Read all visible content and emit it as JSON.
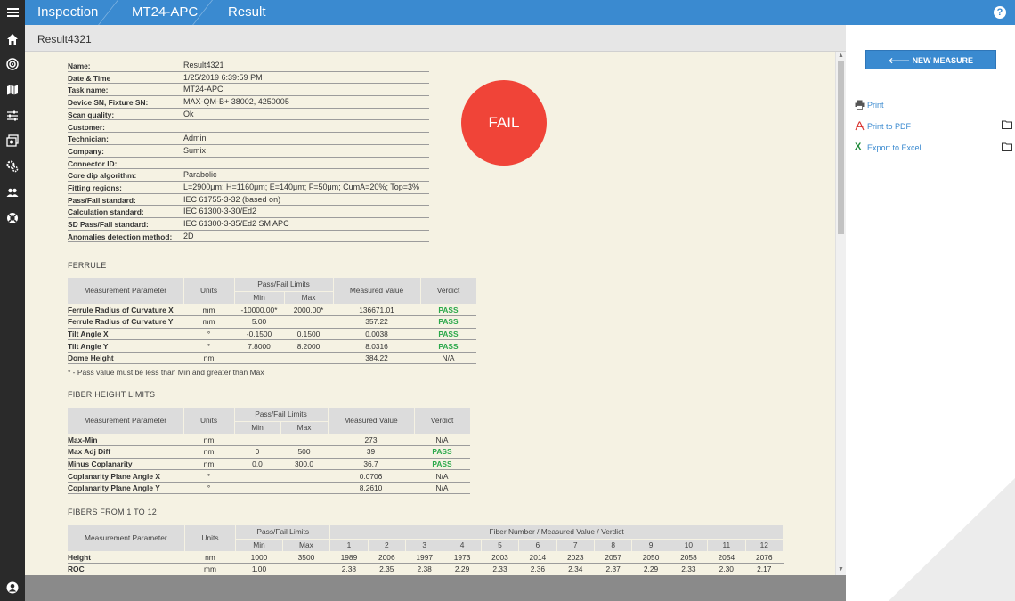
{
  "topbar": {
    "crumbs": [
      "Inspection",
      "MT24-APC",
      "Result"
    ],
    "help_label": "?"
  },
  "result_title": "Result4321",
  "info": [
    {
      "label": "Name:",
      "value": "Result4321"
    },
    {
      "label": "Date & Time",
      "value": "1/25/2019 6:39:59 PM"
    },
    {
      "label": "Task name:",
      "value": "MT24-APC"
    },
    {
      "label": "Device SN, Fixture SN:",
      "value": "MAX-QM-B+ 38002, 4250005"
    },
    {
      "label": "Scan quality:",
      "value": "Ok"
    },
    {
      "label": "Customer:",
      "value": ""
    },
    {
      "label": "Technician:",
      "value": "Admin"
    },
    {
      "label": "Company:",
      "value": "Sumix"
    },
    {
      "label": "Connector ID:",
      "value": ""
    },
    {
      "label": "Core dip algorithm:",
      "value": "Parabolic"
    },
    {
      "label": "Fitting regions:",
      "value": "L=2900μm; H=1160μm; E=140μm; F=50μm; CumA=20%; Top=3%"
    },
    {
      "label": "Pass/Fail standard:",
      "value": "IEC 61755-3-32 (based on)"
    },
    {
      "label": "Calculation standard:",
      "value": "IEC 61300-3-30/Ed2"
    },
    {
      "label": "SD Pass/Fail standard:",
      "value": "IEC 61300-3-35/Ed2 SM APC"
    },
    {
      "label": "Anomalies detection method:",
      "value": "2D"
    }
  ],
  "verdict_badge": "FAIL",
  "headers": {
    "param": "Measurement Parameter",
    "units": "Units",
    "limits": "Pass/Fail Limits",
    "min": "Min",
    "max": "Max",
    "measured": "Measured Value",
    "verdict": "Verdict",
    "fiber_group": "Fiber Number / Measured Value / Verdict"
  },
  "ferrule": {
    "title": "FERRULE",
    "rows": [
      {
        "param": "Ferrule Radius of Curvature X",
        "units": "mm",
        "min": "-10000.00*",
        "max": "2000.00*",
        "value": "136671.01",
        "verdict": "PASS"
      },
      {
        "param": "Ferrule Radius of Curvature Y",
        "units": "mm",
        "min": "5.00",
        "max": "",
        "value": "357.22",
        "verdict": "PASS"
      },
      {
        "param": "Tilt Angle X",
        "units": "°",
        "min": "-0.1500",
        "max": "0.1500",
        "value": "0.0038",
        "verdict": "PASS"
      },
      {
        "param": "Tilt Angle Y",
        "units": "°",
        "min": "7.8000",
        "max": "8.2000",
        "value": "8.0316",
        "verdict": "PASS"
      },
      {
        "param": "Dome Height",
        "units": "nm",
        "min": "",
        "max": "",
        "value": "384.22",
        "verdict": "N/A"
      }
    ],
    "note": "* - Pass value must be less than Min and greater than Max"
  },
  "fiber_height": {
    "title": "FIBER HEIGHT LIMITS",
    "rows": [
      {
        "param": "Max-Min",
        "units": "nm",
        "min": "",
        "max": "",
        "value": "273",
        "verdict": "N/A"
      },
      {
        "param": "Max Adj Diff",
        "units": "nm",
        "min": "0",
        "max": "500",
        "value": "39",
        "verdict": "PASS"
      },
      {
        "param": "Minus Coplanarity",
        "units": "nm",
        "min": "0.0",
        "max": "300.0",
        "value": "36.7",
        "verdict": "PASS"
      },
      {
        "param": "Coplanarity Plane Angle X",
        "units": "°",
        "min": "",
        "max": "",
        "value": "0.0706",
        "verdict": "N/A"
      },
      {
        "param": "Coplanarity Plane Angle Y",
        "units": "°",
        "min": "",
        "max": "",
        "value": "8.2610",
        "verdict": "N/A"
      }
    ]
  },
  "fibers": {
    "title": "FIBERS FROM 1 TO 12",
    "numbers": [
      "1",
      "2",
      "3",
      "4",
      "5",
      "6",
      "7",
      "8",
      "9",
      "10",
      "11",
      "12"
    ],
    "rows": [
      {
        "param": "Height",
        "units": "nm",
        "min": "1000",
        "max": "3500",
        "values": [
          "1989",
          "2006",
          "1997",
          "1973",
          "2003",
          "2014",
          "2023",
          "2057",
          "2050",
          "2058",
          "2054",
          "2076"
        ]
      },
      {
        "param": "ROC",
        "units": "mm",
        "min": "1.00",
        "max": "",
        "values": [
          "2.38",
          "2.35",
          "2.38",
          "2.29",
          "2.33",
          "2.36",
          "2.34",
          "2.37",
          "2.29",
          "2.33",
          "2.30",
          "2.17"
        ]
      }
    ]
  },
  "right_panel": {
    "new_measure": "NEW MEASURE",
    "print": "Print",
    "print_pdf": "Print to PDF",
    "export_excel": "Export to Excel"
  },
  "colors": {
    "accent": "#3a8ad0",
    "fail": "#f04438",
    "pass": "#2aa84a",
    "content_bg": "#f5f2e3"
  }
}
